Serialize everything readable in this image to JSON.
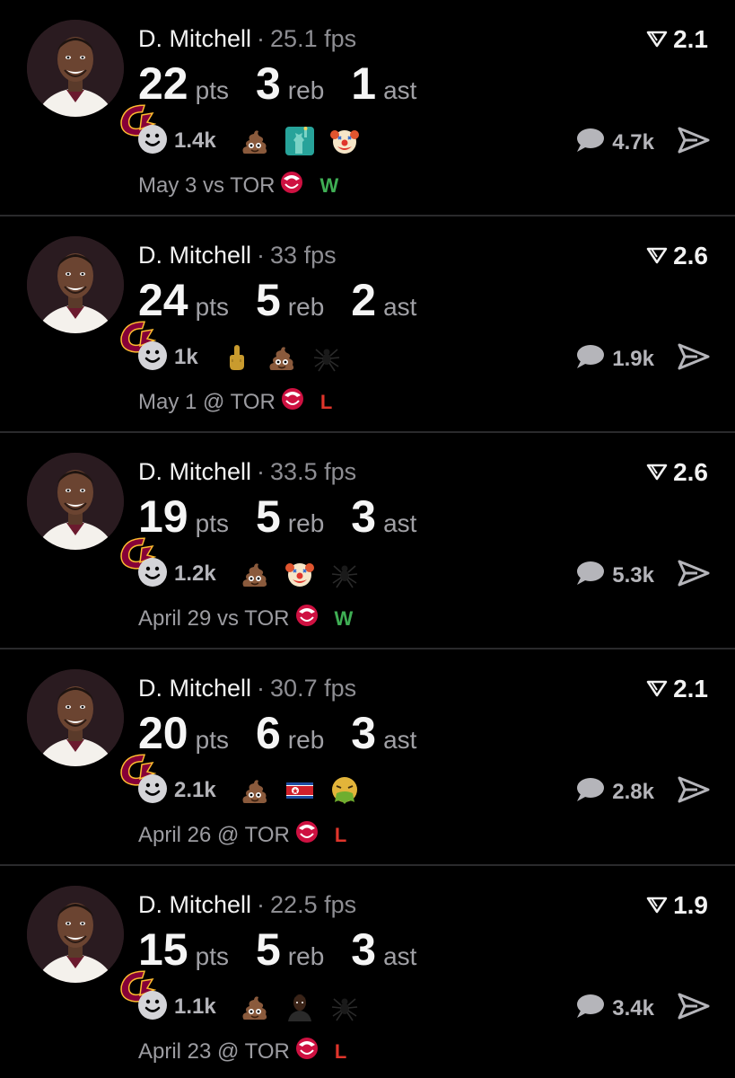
{
  "colors": {
    "background": "#000000",
    "win": "#3fae54",
    "loss": "#e0352b",
    "muted": "#8e8e93"
  },
  "posts": [
    {
      "player": "D. Mitchell",
      "fps": "25.1 fps",
      "rating": "2.1",
      "stats": [
        {
          "num": "22",
          "unit": "pts"
        },
        {
          "num": "3",
          "unit": "reb"
        },
        {
          "num": "1",
          "unit": "ast"
        }
      ],
      "smile_count": "1.4k",
      "emojis": [
        "poop-emoji",
        "statue-of-liberty-emoji",
        "clown-face-emoji"
      ],
      "comment_count": "4.7k",
      "game": "May 3 vs TOR",
      "result": "W"
    },
    {
      "player": "D. Mitchell",
      "fps": "33 fps",
      "rating": "2.6",
      "stats": [
        {
          "num": "24",
          "unit": "pts"
        },
        {
          "num": "5",
          "unit": "reb"
        },
        {
          "num": "2",
          "unit": "ast"
        }
      ],
      "smile_count": "1k",
      "emojis": [
        "middle-finger-emoji",
        "poop-emoji",
        "spider-emoji"
      ],
      "comment_count": "1.9k",
      "game": "May 1 @ TOR",
      "result": "L"
    },
    {
      "player": "D. Mitchell",
      "fps": "33.5 fps",
      "rating": "2.6",
      "stats": [
        {
          "num": "19",
          "unit": "pts"
        },
        {
          "num": "5",
          "unit": "reb"
        },
        {
          "num": "3",
          "unit": "ast"
        }
      ],
      "smile_count": "1.2k",
      "emojis": [
        "poop-emoji",
        "clown-face-emoji",
        "spider-emoji"
      ],
      "comment_count": "5.3k",
      "game": "April 29 vs TOR",
      "result": "W"
    },
    {
      "player": "D. Mitchell",
      "fps": "30.7 fps",
      "rating": "2.1",
      "stats": [
        {
          "num": "20",
          "unit": "pts"
        },
        {
          "num": "6",
          "unit": "reb"
        },
        {
          "num": "3",
          "unit": "ast"
        }
      ],
      "smile_count": "2.1k",
      "emojis": [
        "poop-emoji",
        "north-korea-flag-emoji",
        "vomiting-face-emoji"
      ],
      "comment_count": "2.8k",
      "game": "April 26 @ TOR",
      "result": "L"
    },
    {
      "player": "D. Mitchell",
      "fps": "22.5 fps",
      "rating": "1.9",
      "stats": [
        {
          "num": "15",
          "unit": "pts"
        },
        {
          "num": "5",
          "unit": "reb"
        },
        {
          "num": "3",
          "unit": "ast"
        }
      ],
      "smile_count": "1.1k",
      "emojis": [
        "poop-emoji",
        "person-emoji",
        "spider-emoji"
      ],
      "comment_count": "3.4k",
      "game": "April 23 @ TOR",
      "result": "L"
    }
  ]
}
